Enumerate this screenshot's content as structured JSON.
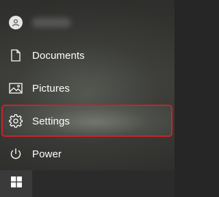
{
  "start_menu": {
    "items": [
      {
        "name": "user-account",
        "label": "",
        "icon": "avatar-icon"
      },
      {
        "name": "documents",
        "label": "Documents",
        "icon": "document-icon"
      },
      {
        "name": "pictures",
        "label": "Pictures",
        "icon": "picture-icon"
      },
      {
        "name": "settings",
        "label": "Settings",
        "icon": "gear-icon",
        "highlighted": true
      },
      {
        "name": "power",
        "label": "Power",
        "icon": "power-icon"
      }
    ],
    "highlight_color": "#d0202a"
  },
  "taskbar": {
    "start_button_icon": "windows-logo-icon"
  }
}
